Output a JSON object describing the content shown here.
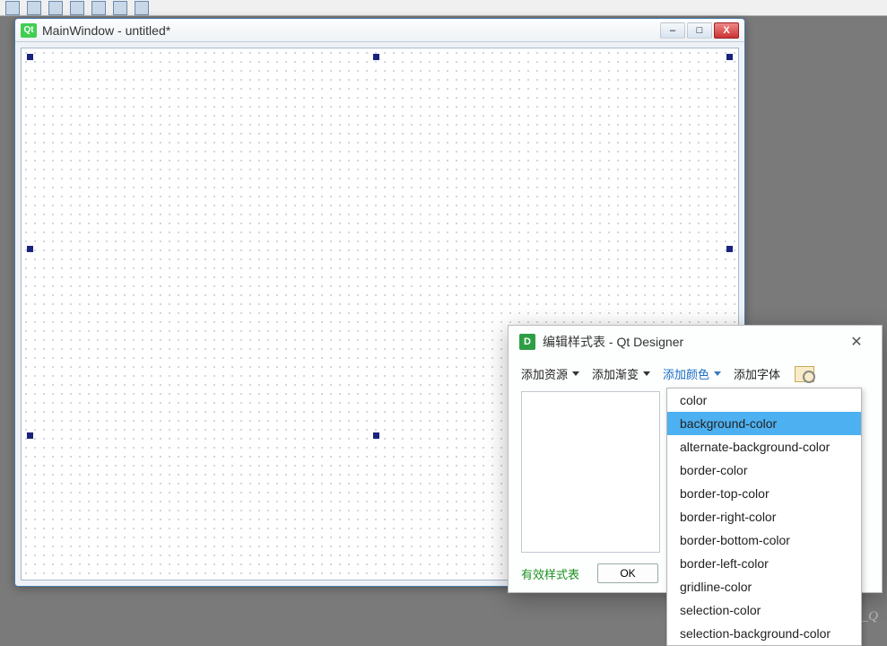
{
  "toolbar_top": {
    "icons": [
      "undo",
      "redo",
      "cut",
      "copy",
      "paste",
      "widget",
      "layout",
      "break"
    ]
  },
  "main_window": {
    "badge": "Qt",
    "title": "MainWindow - untitled*",
    "controls": {
      "min": "–",
      "max": "□",
      "close": "X"
    }
  },
  "dialog": {
    "badge": "D",
    "title": "编辑样式表 - Qt Designer",
    "toolbar": {
      "add_resource": "添加资源",
      "add_gradient": "添加渐变",
      "add_color": "添加颜色",
      "add_font": "添加字体"
    },
    "bottom": {
      "valid": "有效样式表",
      "ok": "OK"
    }
  },
  "color_menu": {
    "items": [
      "color",
      "background-color",
      "alternate-background-color",
      "border-color",
      "border-top-color",
      "border-right-color",
      "border-bottom-color",
      "border-left-color",
      "gridline-color",
      "selection-color",
      "selection-background-color"
    ],
    "selected_index": 1
  },
  "watermark": "CSDN @WYKB_Mr_Q"
}
